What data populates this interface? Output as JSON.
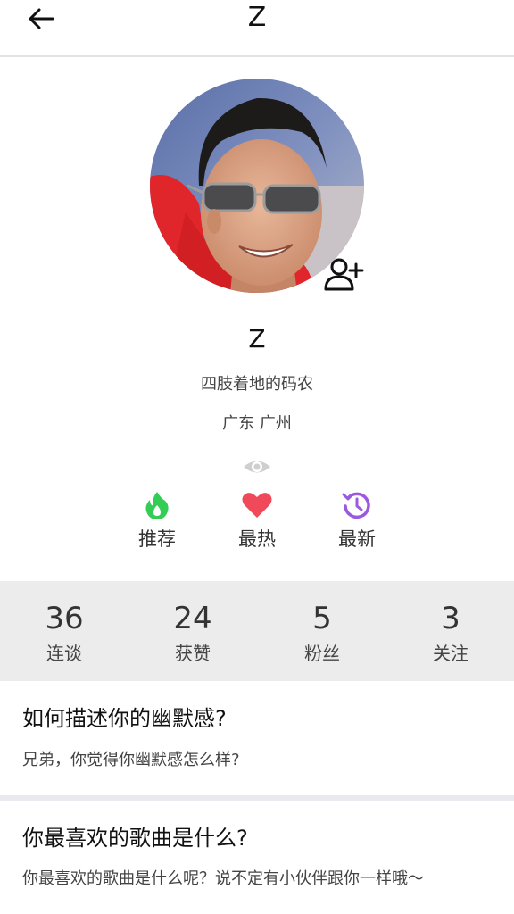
{
  "header": {
    "title": "Z"
  },
  "profile": {
    "name": "Z",
    "bio": "四肢着地的码农",
    "location": "广东 广州"
  },
  "tabs": [
    {
      "label": "推荐",
      "icon": "flame-icon",
      "color": "#33cc55"
    },
    {
      "label": "最热",
      "icon": "heart-icon",
      "color": "#f04a5a"
    },
    {
      "label": "最新",
      "icon": "history-icon",
      "color": "#9b59e0"
    }
  ],
  "stats": [
    {
      "value": "36",
      "label": "连谈"
    },
    {
      "value": "24",
      "label": "获赞"
    },
    {
      "value": "5",
      "label": "粉丝"
    },
    {
      "value": "3",
      "label": "关注"
    }
  ],
  "questions": [
    {
      "title": "如何描述你的幽默感?",
      "subtitle": "兄弟，你觉得你幽默感怎么样?"
    },
    {
      "title": "你最喜欢的歌曲是什么?",
      "subtitle": "你最喜欢的歌曲是什么呢？说不定有小伙伴跟你一样哦～"
    }
  ]
}
